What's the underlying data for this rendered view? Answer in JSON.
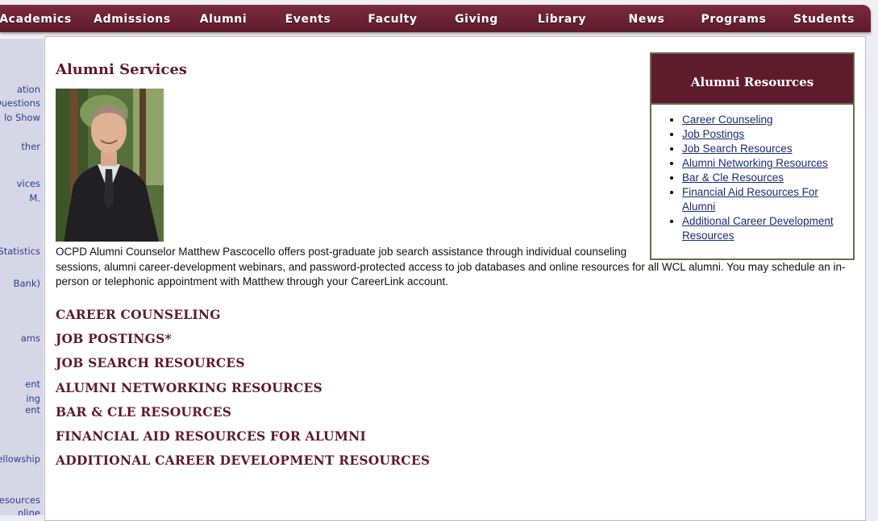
{
  "nav": {
    "items": [
      "Academics",
      "Admissions",
      "Alumni",
      "Events",
      "Faculty",
      "Giving",
      "Library",
      "News",
      "Programs",
      "Students"
    ]
  },
  "sidebar": {
    "items": [
      "ation",
      "Questions",
      "lo Show",
      "ther",
      "vices",
      "M.",
      "t Statistics",
      "Bank)",
      "ams",
      "ent",
      "ing",
      "ent",
      "ellowship",
      "Resources",
      "nline"
    ]
  },
  "main": {
    "title": "Alumni Services",
    "photo_alt": "Matthew Pascocello",
    "intro_line1": "OCPD Alumni Counselor Matthew Pascocello offers post-graduate job search assistance through individual counseling",
    "intro_rest": "sessions, alumni career-development webinars, and password-protected access to job databases and online resources for all WCL alumni. You may schedule an in-person or telephonic appointment with Matthew through your CareerLink account.",
    "sections": [
      "CAREER COUNSELING",
      "JOB POSTINGS*",
      "JOB SEARCH RESOURCES",
      "ALUMNI NETWORKING RESOURCES",
      "BAR & CLE RESOURCES",
      "FINANCIAL AID RESOURCES FOR ALUMNI",
      "ADDITIONAL CAREER DEVELOPMENT RESOURCES"
    ]
  },
  "resources": {
    "title": "Alumni Resources",
    "links": [
      "Career Counseling",
      "Job Postings",
      "Job Search Resources",
      "Alumni Networking Resources",
      "Bar & Cle Resources",
      "Financial Aid Resources For Alumni",
      "Additional Career Development Resources"
    ]
  },
  "colors": {
    "brand": "#5e1b2c",
    "link": "#1a2c6e",
    "sidebar_link": "#2d3d8f"
  }
}
